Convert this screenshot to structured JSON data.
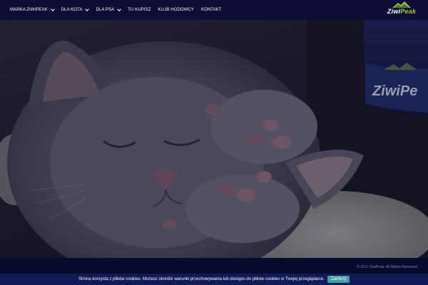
{
  "nav": {
    "items": [
      {
        "label": "MARKA ZIWIPEAK",
        "has_dropdown": true
      },
      {
        "label": "DLA KOTA",
        "has_dropdown": true
      },
      {
        "label": "DLA PSA",
        "has_dropdown": true
      },
      {
        "label": "TU KUPISZ",
        "has_dropdown": false
      },
      {
        "label": "KLUB HODOWCY",
        "has_dropdown": false
      },
      {
        "label": "KONTAKT",
        "has_dropdown": false
      }
    ]
  },
  "logo": {
    "brand_part1": "Ziwi",
    "brand_part2": "Peak"
  },
  "hero": {
    "background_logo_text": "ZiwiPe"
  },
  "footer": {
    "copyright": "© 2017 ZiwiPeak. All Rights Reserved."
  },
  "cookie": {
    "message": "Strona korzysta z plików cookies. Możesz określić warunki przechowywania lub dostępu do plików cookies w Twojej przeglądarce.",
    "button_label": "Zamknij"
  },
  "colors": {
    "nav_bg": "#0d0d36",
    "footer_bg": "#070b2c",
    "cookie_bg": "#101a56",
    "button_bg": "#3f9ea8",
    "logo_accent": "#a6c93d"
  }
}
